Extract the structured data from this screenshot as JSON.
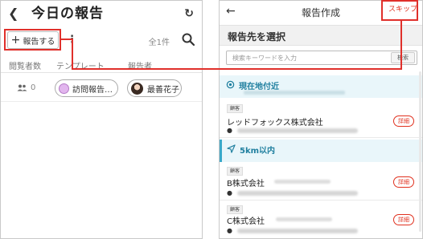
{
  "left_screen": {
    "title": "今日の報告",
    "add_report_label": "報告する",
    "count_label": "全1件",
    "columns": [
      "閲覧者数",
      "テンプレート",
      "報告者"
    ],
    "row": {
      "view_count": "0",
      "template": "訪問報告…",
      "reporter": "最善花子"
    },
    "icons": {
      "back": "chevron-left-icon",
      "refresh": "refresh-icon",
      "add": "plus-icon",
      "more": "kebab-menu-icon",
      "search": "search-icon",
      "views": "people-icon"
    }
  },
  "right_screen": {
    "title": "報告作成",
    "skip_label": "スキップ",
    "subtitle": "報告先を選択",
    "search": {
      "placeholder": "検索キーワードを入力",
      "button_label": "検索"
    },
    "sections": [
      {
        "title": "現在地付近",
        "icon": "location-target-icon"
      },
      {
        "title": "5km以内",
        "icon": "navigation-arrow-icon"
      }
    ],
    "customers": [
      {
        "badge": "顧客",
        "name": "レッドフォックス株式会社",
        "detail_label": "詳細"
      },
      {
        "badge": "顧客",
        "name": "B株式会社",
        "detail_label": "詳細"
      },
      {
        "badge": "顧客",
        "name": "C株式会社",
        "detail_label": "詳細"
      }
    ]
  },
  "colors": {
    "highlight": "#e0302b",
    "accent_teal": "#1f7f9f",
    "section_bg": "#e9f6fa",
    "detail_red": "#e0301e"
  }
}
